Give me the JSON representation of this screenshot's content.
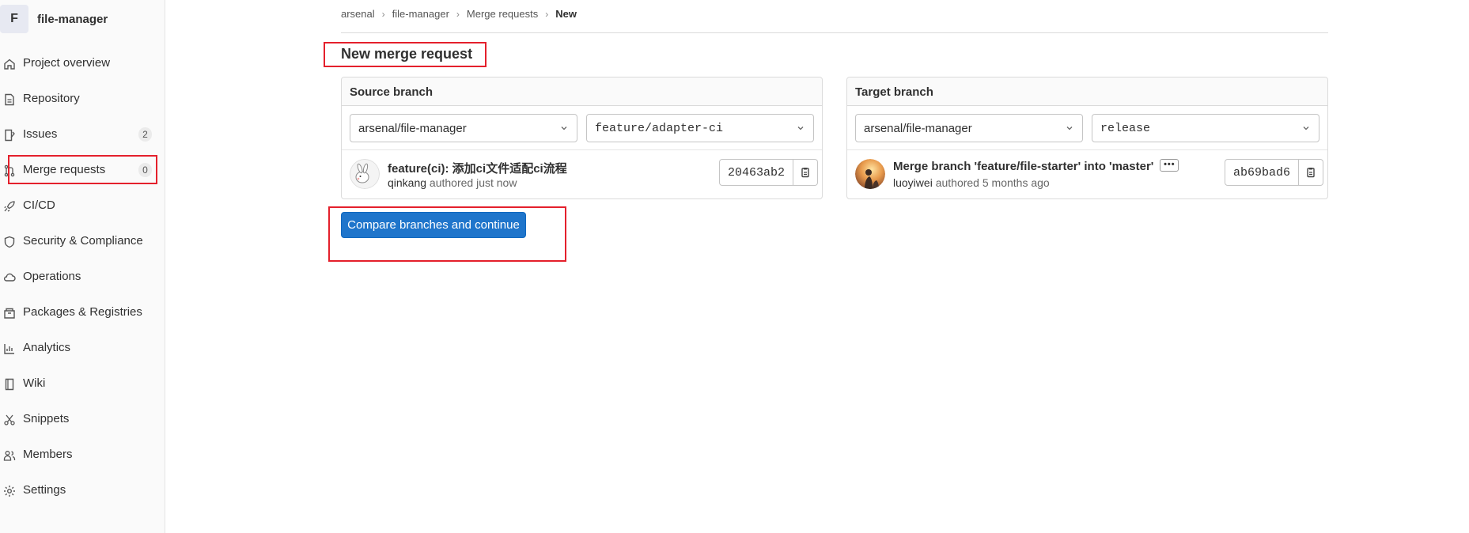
{
  "project": {
    "avatar_letter": "F",
    "name": "file-manager"
  },
  "sidebar": {
    "items": [
      {
        "label": "Project overview",
        "icon": "home-icon"
      },
      {
        "label": "Repository",
        "icon": "document-icon"
      },
      {
        "label": "Issues",
        "icon": "issues-icon",
        "badge": "2"
      },
      {
        "label": "Merge requests",
        "icon": "merge-request-icon",
        "badge": "0"
      },
      {
        "label": "CI/CD",
        "icon": "rocket-icon"
      },
      {
        "label": "Security & Compliance",
        "icon": "shield-icon"
      },
      {
        "label": "Operations",
        "icon": "cloud-gear-icon"
      },
      {
        "label": "Packages & Registries",
        "icon": "package-icon"
      },
      {
        "label": "Analytics",
        "icon": "chart-icon"
      },
      {
        "label": "Wiki",
        "icon": "book-icon"
      },
      {
        "label": "Snippets",
        "icon": "scissors-icon"
      },
      {
        "label": "Members",
        "icon": "users-icon"
      },
      {
        "label": "Settings",
        "icon": "gear-icon"
      }
    ]
  },
  "breadcrumb": {
    "items": [
      "arsenal",
      "file-manager",
      "Merge requests"
    ],
    "current": "New"
  },
  "page": {
    "title": "New merge request"
  },
  "source": {
    "header": "Source branch",
    "project": "arsenal/file-manager",
    "branch": "feature/adapter-ci",
    "commit_title": "feature(ci): 添加ci文件适配ci流程",
    "author": "qinkang",
    "authored_text": " authored just now",
    "sha": "20463ab2"
  },
  "target": {
    "header": "Target branch",
    "project": "arsenal/file-manager",
    "branch": "release",
    "commit_title": "Merge branch 'feature/file-starter' into 'master'",
    "more_label": "•••",
    "author": "luoyiwei",
    "authored_text": " authored 5 months ago",
    "sha": "ab69bad6"
  },
  "actions": {
    "compare_label": "Compare branches and continue"
  },
  "colors": {
    "primary": "#1f75cb",
    "highlight": "#e4202c"
  }
}
